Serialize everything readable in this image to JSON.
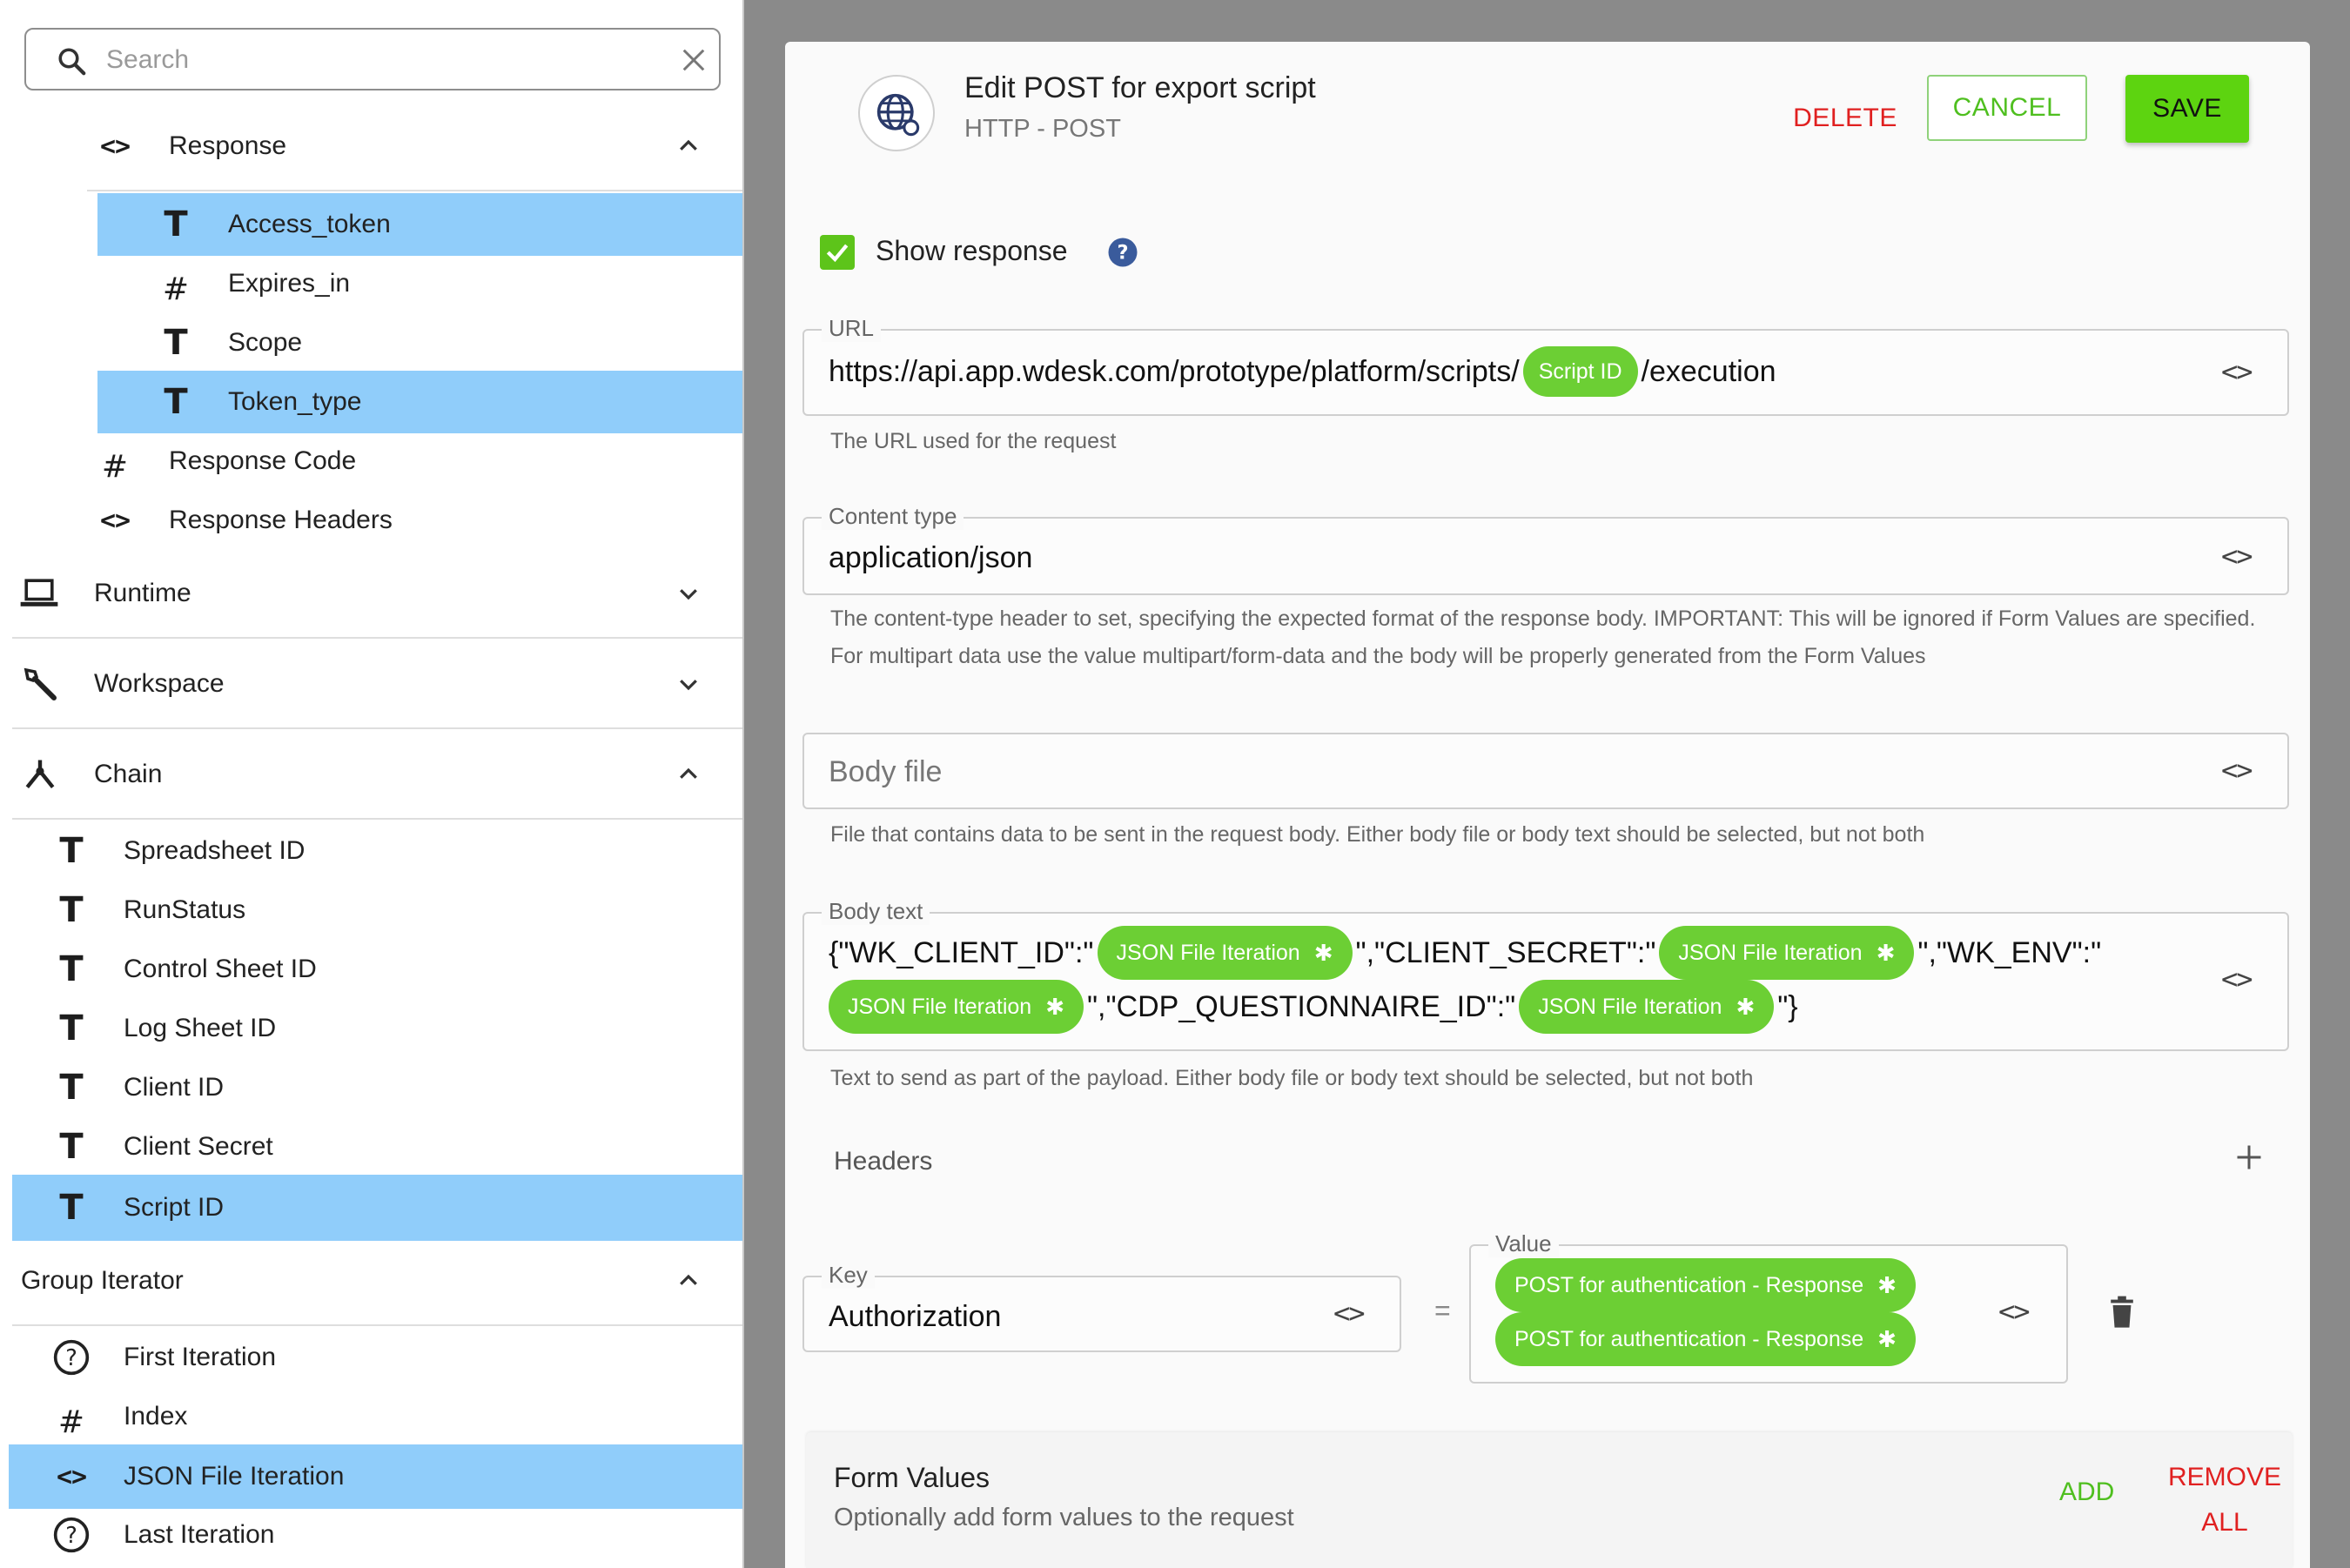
{
  "search": {
    "placeholder": "Search"
  },
  "tree": {
    "response": {
      "label": "Response",
      "icon": "code-brackets-icon"
    },
    "response_children": [
      {
        "label": "Access_token",
        "type": "T",
        "selected": true
      },
      {
        "label": "Expires_in",
        "type": "#",
        "selected": false
      },
      {
        "label": "Scope",
        "type": "T",
        "selected": false
      },
      {
        "label": "Token_type",
        "type": "T",
        "selected": true
      }
    ],
    "response_code": "Response Code",
    "response_headers": "Response Headers",
    "runtime": "Runtime",
    "workspace": "Workspace",
    "chain": "Chain",
    "chain_items": [
      {
        "label": "Spreadsheet ID",
        "selected": false
      },
      {
        "label": "RunStatus",
        "selected": false
      },
      {
        "label": "Control Sheet ID",
        "selected": false
      },
      {
        "label": "Log Sheet ID",
        "selected": false
      },
      {
        "label": "Client ID",
        "selected": false
      },
      {
        "label": "Client Secret",
        "selected": false
      },
      {
        "label": "Script ID",
        "selected": true
      }
    ],
    "group_iterator": "Group Iterator",
    "group_items": [
      {
        "label": "First Iteration",
        "icon": "question-circle-icon",
        "selected": false
      },
      {
        "label": "Index",
        "icon": "hash-icon",
        "selected": false
      },
      {
        "label": "JSON File Iteration",
        "icon": "code-brackets-icon",
        "selected": true
      },
      {
        "label": "Last Iteration",
        "icon": "question-circle-icon",
        "selected": false
      }
    ]
  },
  "dialog": {
    "title": "Edit POST for export script",
    "subtitle": "HTTP - POST",
    "delete_label": "DELETE",
    "cancel_label": "CANCEL",
    "save_label": "SAVE",
    "show_response": {
      "label": "Show response",
      "checked": true
    },
    "url": {
      "label": "URL",
      "prefix": "https://api.app.wdesk.com/prototype/platform/scripts/",
      "chip": "Script ID",
      "suffix": "/execution",
      "hint": "The URL used for the request"
    },
    "content_type": {
      "label": "Content type",
      "value": "application/json",
      "hint_line1": "The content-type header to set, specifying the expected format of the response body. IMPORTANT: This will be ignored if Form Values are specified.",
      "hint_line2": "For multipart data use the value multipart/form-data and the body will be properly generated from the Form Values"
    },
    "body_file": {
      "placeholder": "Body file",
      "hint": "File that contains data to be sent in the request body. Either body file or body text should be selected, but not both"
    },
    "body_text": {
      "label": "Body text",
      "t1": "{\"WK_CLIENT_ID\":\"",
      "chip1": "JSON File Iteration",
      "t2": "\",\"CLIENT_SECRET\":\"",
      "chip2": "JSON File Iteration",
      "t3": "\",\"WK_ENV\":\"",
      "chip3": "JSON File Iteration",
      "t4": "\",\"CDP_QUESTIONNAIRE_ID\":\"",
      "chip4": "JSON File Iteration",
      "t5": "\"}",
      "hint": "Text to send as part of the payload. Either body file or body text should be selected, but not both"
    },
    "headers": {
      "label": "Headers",
      "key_label": "Key",
      "key_value": "Authorization",
      "equals": "=",
      "value_label": "Value",
      "value_chips": [
        "POST for authentication - Response",
        "POST for authentication - Response"
      ]
    },
    "form_values": {
      "title": "Form Values",
      "subtitle": "Optionally add form values to the request",
      "add_label": "ADD",
      "remove_line1": "REMOVE",
      "remove_line2": "ALL"
    }
  },
  "colors": {
    "selection": "#90cdfa",
    "accent_green": "#5dd410",
    "chip_green": "#6ccf34",
    "danger_red": "#e02020"
  }
}
